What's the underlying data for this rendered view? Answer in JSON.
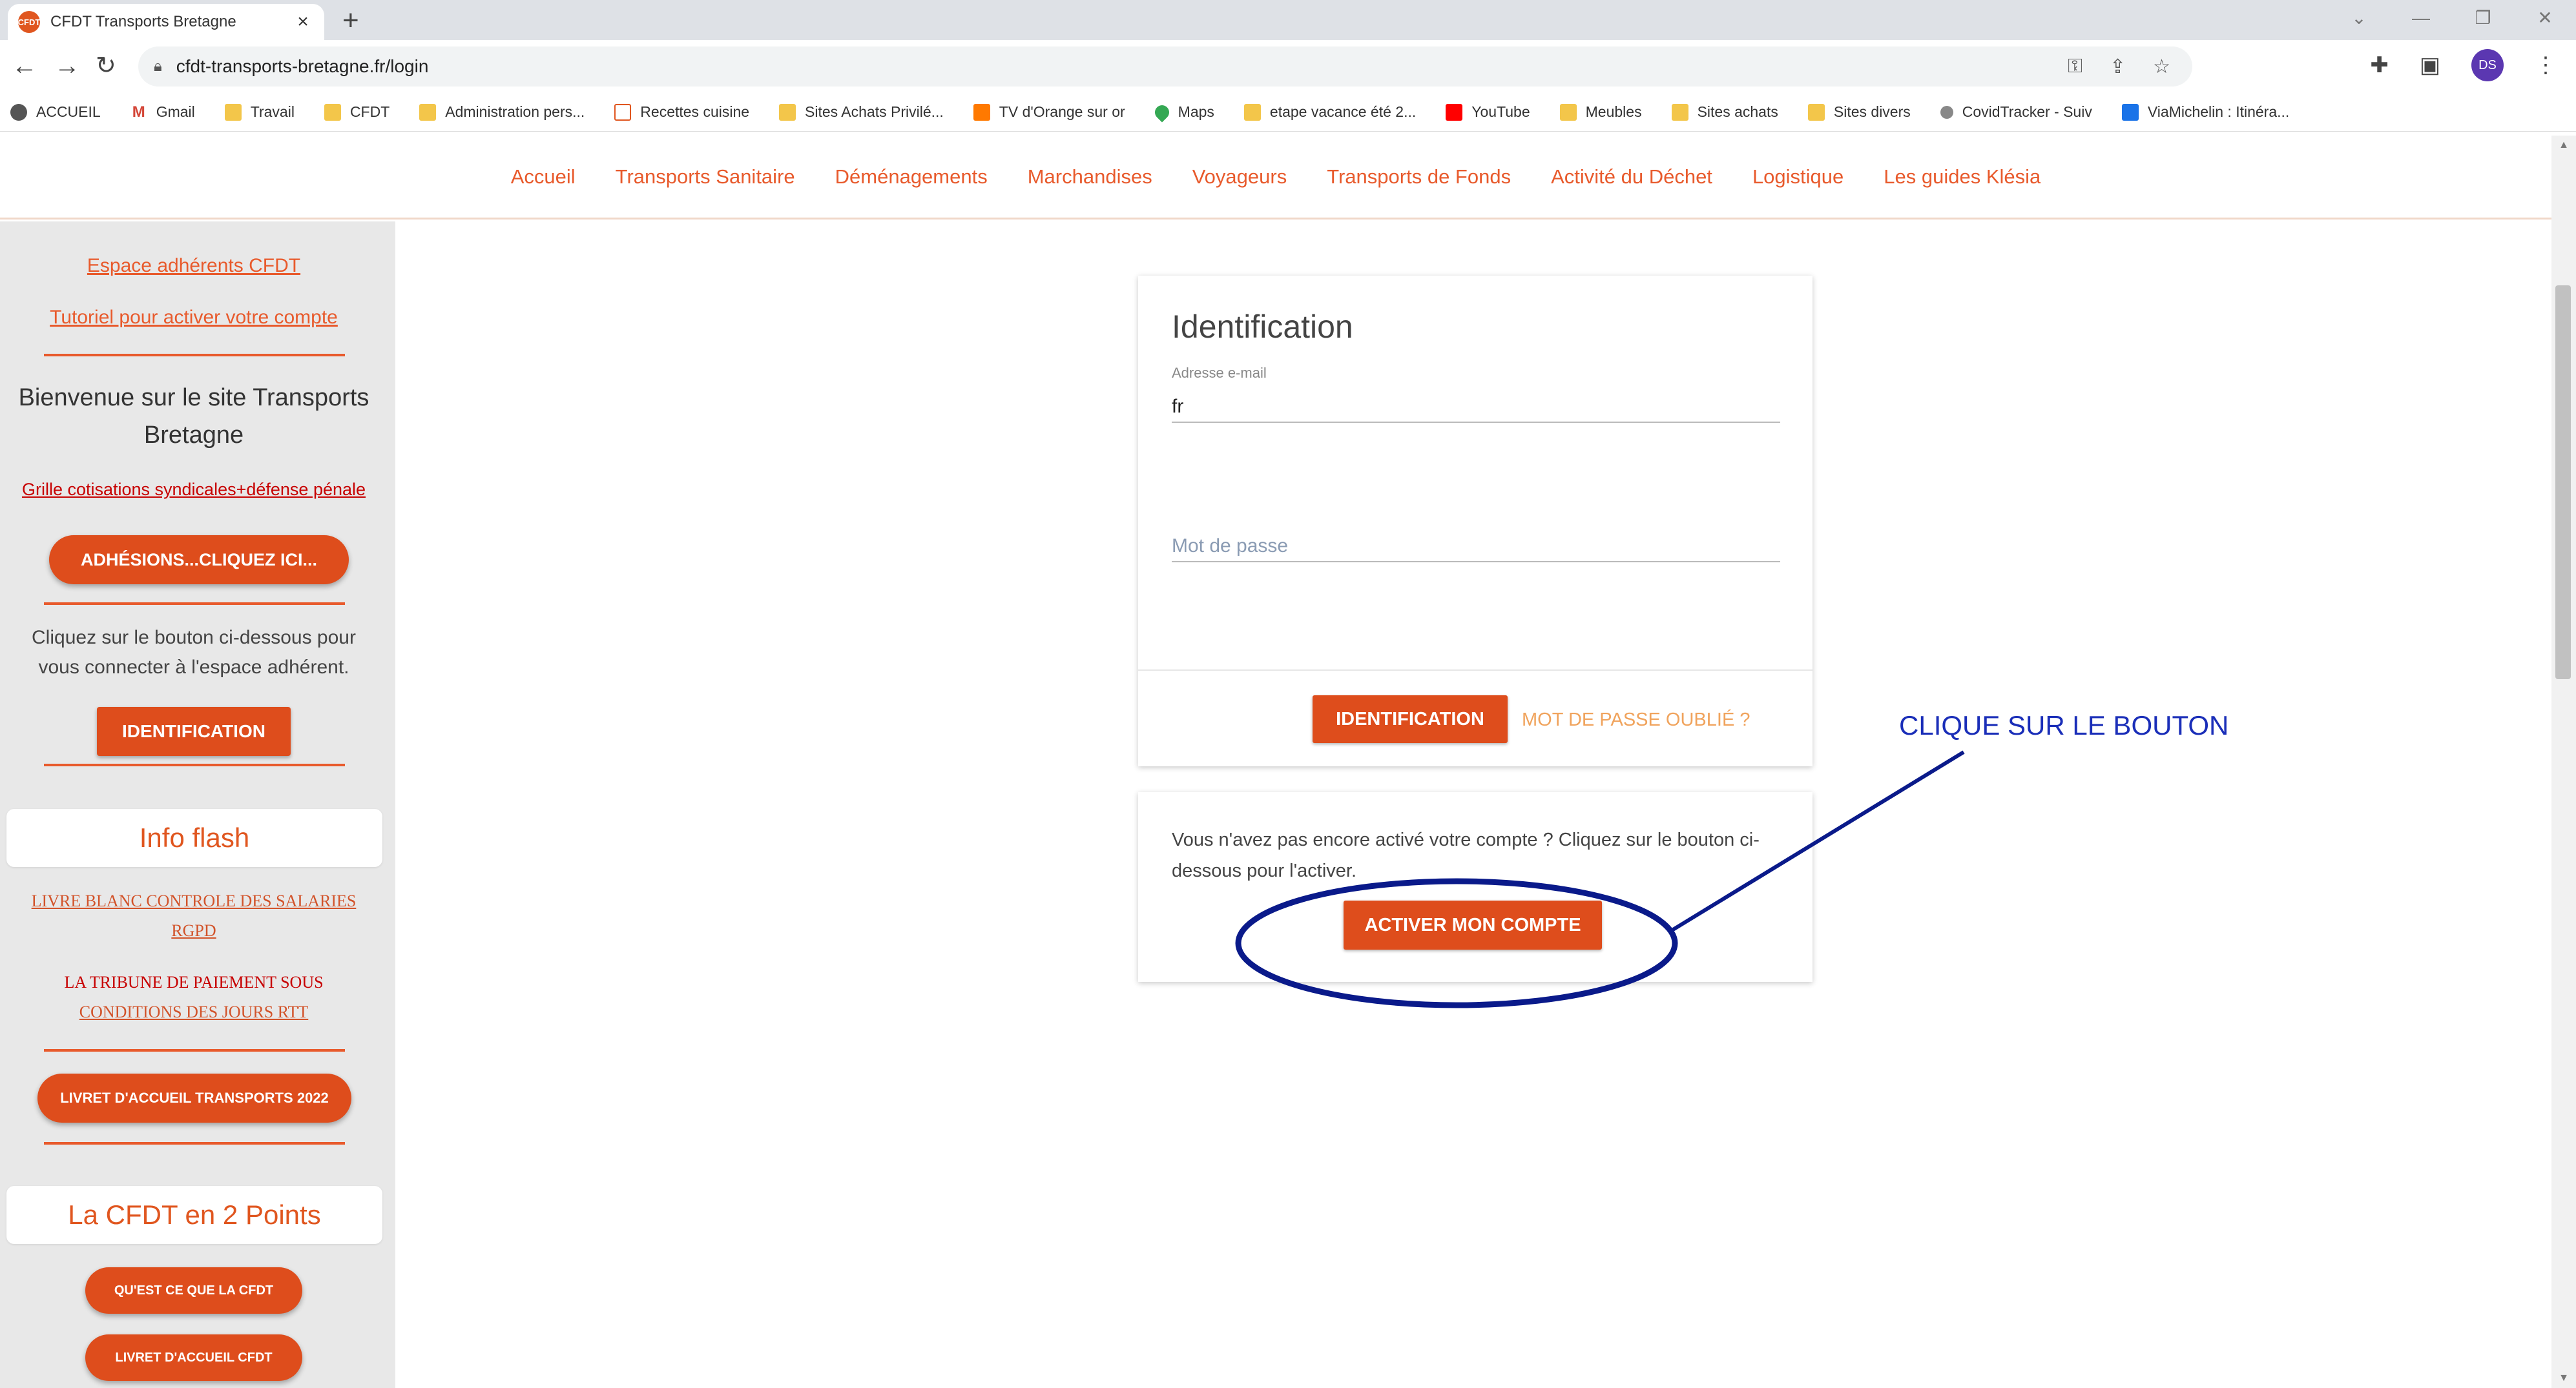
{
  "browser": {
    "tab_title": "CFDT Transports Bretagne",
    "favicon_text": "CFDT",
    "url_host": "cfdt-transports-bretagne.fr",
    "url_path": "/login",
    "avatar_initials": "DS",
    "bookmarks": [
      {
        "label": "ACCUEIL",
        "icon": "globe-icon"
      },
      {
        "label": "Gmail",
        "icon": "gmail-icon"
      },
      {
        "label": "Travail",
        "icon": "folder-icon"
      },
      {
        "label": "CFDT",
        "icon": "folder-icon"
      },
      {
        "label": "Administration pers...",
        "icon": "folder-icon"
      },
      {
        "label": "Recettes cuisine",
        "icon": "page-icon"
      },
      {
        "label": "Sites Achats Privilé...",
        "icon": "folder-icon"
      },
      {
        "label": "TV d'Orange sur or",
        "icon": "tv-icon"
      },
      {
        "label": "Maps",
        "icon": "maps-icon"
      },
      {
        "label": "etape vacance été 2...",
        "icon": "folder-icon"
      },
      {
        "label": "YouTube",
        "icon": "youtube-icon"
      },
      {
        "label": "Meubles",
        "icon": "folder-icon"
      },
      {
        "label": "Sites achats",
        "icon": "folder-icon"
      },
      {
        "label": "Sites divers",
        "icon": "folder-icon"
      },
      {
        "label": "CovidTracker - Suiv",
        "icon": "covid-icon"
      },
      {
        "label": "ViaMichelin : Itinéra...",
        "icon": "viamichelin-icon"
      }
    ]
  },
  "site_nav": [
    "Accueil",
    "Transports Sanitaire",
    "Déménagements",
    "Marchandises",
    "Voyageurs",
    "Transports de Fonds",
    "Activité du Déchet",
    "Logistique",
    "Les guides Klésia"
  ],
  "sidebar": {
    "espace_link": "Espace adhérents CFDT",
    "tutoriel_link": "Tutoriel pour activer votre compte",
    "welcome_line1": "Bienvenue sur le site Transports",
    "welcome_line2": "Bretagne",
    "grille_link": "Grille cotisations syndicales+défense pénale",
    "adhesions_button": "ADHÉSIONS...CLIQUEZ ICI...",
    "connect_text_line1": "Cliquez sur le bouton ci-dessous pour",
    "connect_text_line2": "vous connecter à l'espace adhérent.",
    "identification_button": "IDENTIFICATION",
    "info_flash_title": "Info flash",
    "livre_blanc_line1": "LIVRE BLANC CONTROLE DES SALARIES",
    "livre_blanc_line2": "RGPD",
    "tribune_line1": "LA TRIBUNE DE PAIEMENT SOUS",
    "tribune_line2": "CONDITIONS DES JOURS RTT",
    "livret_transports_button": "LIVRET D'ACCUEIL TRANSPORTS 2022",
    "cfdt_points_title": "La CFDT en 2 Points",
    "quest_button": "QU'EST CE QUE LA CFDT",
    "livret_cfdt_button": "LIVRET D'ACCUEIL CFDT"
  },
  "login": {
    "title": "Identification",
    "email_label": "Adresse e-mail",
    "email_value": "fr",
    "password_placeholder": "Mot de passe",
    "submit_button": "IDENTIFICATION",
    "forgot_link": "MOT DE PASSE OUBLIÉ ?"
  },
  "activate": {
    "text": "Vous n'avez pas encore activé votre compte ? Cliquez sur le bouton ci-dessous pour l'activer.",
    "button": "ACTIVER MON COMPTE"
  },
  "annotation": {
    "text": "CLIQUE SUR LE BOUTON",
    "color": "#1a2eb8"
  },
  "colors": {
    "accent": "#de4d1c",
    "nav_text": "#e85a2c",
    "annotation": "#0a1a8a"
  }
}
